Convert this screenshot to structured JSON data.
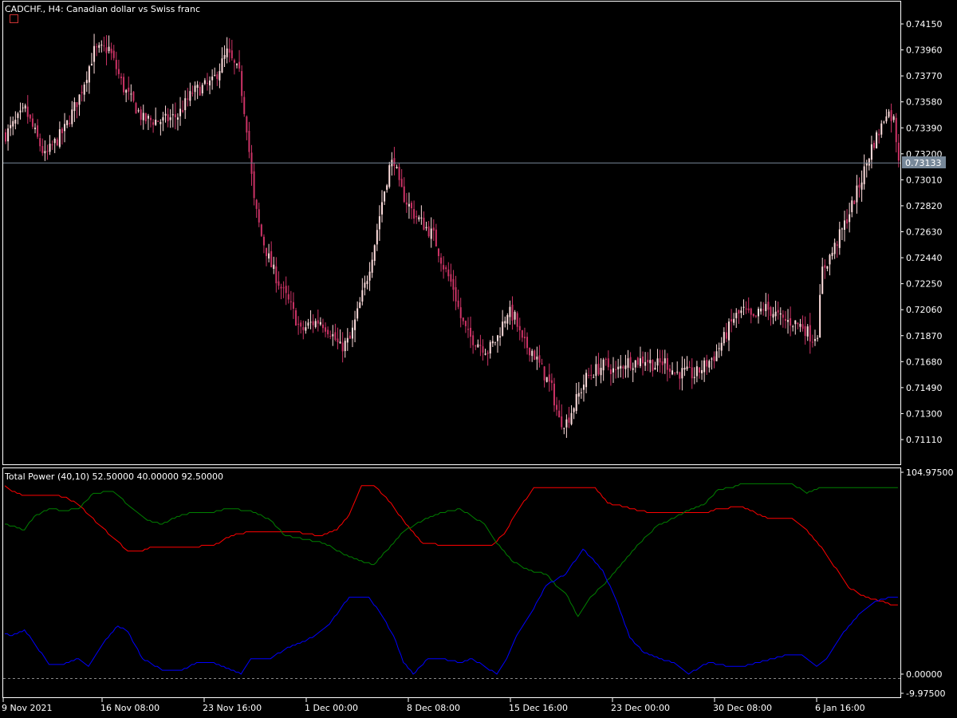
{
  "chart_data": [
    {
      "type": "candlestick",
      "title": "CADCHF., H4:  Canadian dollar vs Swiss franc",
      "y_ticks": [
        "0.74150",
        "0.73960",
        "0.73770",
        "0.73580",
        "0.73390",
        "0.73200",
        "0.73010",
        "0.72820",
        "0.72630",
        "0.72440",
        "0.72250",
        "0.72060",
        "0.71870",
        "0.71680",
        "0.71490",
        "0.71300",
        "0.71110"
      ],
      "ylim": [
        0.71,
        0.7427
      ],
      "current_price": "0.73133",
      "close_anchors": [
        [
          0,
          0.7334
        ],
        [
          8,
          0.7352
        ],
        [
          16,
          0.7318
        ],
        [
          24,
          0.7338
        ],
        [
          30,
          0.7362
        ],
        [
          36,
          0.7395
        ],
        [
          42,
          0.7397
        ],
        [
          48,
          0.7368
        ],
        [
          56,
          0.7345
        ],
        [
          64,
          0.7344
        ],
        [
          70,
          0.7348
        ],
        [
          76,
          0.7365
        ],
        [
          84,
          0.7372
        ],
        [
          90,
          0.7394
        ],
        [
          95,
          0.7378
        ],
        [
          98,
          0.734
        ],
        [
          101,
          0.7285
        ],
        [
          104,
          0.726
        ],
        [
          108,
          0.7238
        ],
        [
          112,
          0.7222
        ],
        [
          116,
          0.7208
        ],
        [
          120,
          0.719
        ],
        [
          124,
          0.7196
        ],
        [
          128,
          0.7198
        ],
        [
          132,
          0.719
        ],
        [
          136,
          0.7178
        ],
        [
          140,
          0.7184
        ],
        [
          144,
          0.721
        ],
        [
          147,
          0.723
        ],
        [
          150,
          0.7255
        ],
        [
          153,
          0.7285
        ],
        [
          156,
          0.731
        ],
        [
          158,
          0.7316
        ],
        [
          160,
          0.7296
        ],
        [
          163,
          0.7285
        ],
        [
          166,
          0.7276
        ],
        [
          170,
          0.7268
        ],
        [
          174,
          0.726
        ],
        [
          178,
          0.7238
        ],
        [
          182,
          0.7222
        ],
        [
          185,
          0.72
        ],
        [
          188,
          0.7187
        ],
        [
          192,
          0.7182
        ],
        [
          196,
          0.7176
        ],
        [
          200,
          0.7186
        ],
        [
          204,
          0.7205
        ],
        [
          207,
          0.72
        ],
        [
          210,
          0.7182
        ],
        [
          214,
          0.7176
        ],
        [
          218,
          0.7162
        ],
        [
          222,
          0.7148
        ],
        [
          225,
          0.7125
        ],
        [
          228,
          0.7124
        ],
        [
          232,
          0.714
        ],
        [
          236,
          0.7156
        ],
        [
          240,
          0.7162
        ],
        [
          244,
          0.7166
        ],
        [
          248,
          0.716
        ],
        [
          252,
          0.7168
        ],
        [
          256,
          0.7168
        ],
        [
          260,
          0.717
        ],
        [
          264,
          0.7165
        ],
        [
          268,
          0.7168
        ],
        [
          272,
          0.716
        ],
        [
          276,
          0.716
        ],
        [
          280,
          0.7158
        ],
        [
          284,
          0.7165
        ],
        [
          288,
          0.7172
        ],
        [
          292,
          0.7185
        ],
        [
          296,
          0.72
        ],
        [
          300,
          0.7205
        ],
        [
          304,
          0.7198
        ],
        [
          308,
          0.7208
        ],
        [
          312,
          0.7204
        ],
        [
          316,
          0.7198
        ],
        [
          320,
          0.7197
        ],
        [
          324,
          0.7194
        ],
        [
          328,
          0.7185
        ],
        [
          330,
          0.719
        ],
        [
          332,
          0.7235
        ],
        [
          336,
          0.7248
        ],
        [
          340,
          0.7264
        ],
        [
          344,
          0.7282
        ],
        [
          348,
          0.7302
        ],
        [
          352,
          0.7325
        ],
        [
          356,
          0.734
        ],
        [
          358,
          0.7352
        ],
        [
          361,
          0.7345
        ],
        [
          363,
          0.7318
        ]
      ]
    },
    {
      "type": "line",
      "title": "Total Power (40,10) 52.50000 40.00000 92.50000",
      "y_ticks": [
        "104.97500",
        "0.00000",
        "-9.97500"
      ],
      "ylim": [
        -9.975,
        104.975
      ],
      "series": [
        {
          "color": "#ff0000",
          "anchors": [
            [
              0,
              98
            ],
            [
              3,
              95
            ],
            [
              8,
              93
            ],
            [
              20,
              93
            ],
            [
              25,
              92
            ],
            [
              30,
              88
            ],
            [
              38,
              78
            ],
            [
              45,
              70
            ],
            [
              50,
              64
            ],
            [
              55,
              64
            ],
            [
              60,
              66
            ],
            [
              75,
              66
            ],
            [
              85,
              67
            ],
            [
              92,
              72
            ],
            [
              100,
              74
            ],
            [
              118,
              74
            ],
            [
              128,
              72
            ],
            [
              135,
              75
            ],
            [
              140,
              83
            ],
            [
              145,
              98
            ],
            [
              150,
              98
            ],
            [
              155,
              92
            ],
            [
              163,
              78
            ],
            [
              170,
              68
            ],
            [
              180,
              67
            ],
            [
              198,
              67
            ],
            [
              203,
              73
            ],
            [
              208,
              84
            ],
            [
              215,
              97
            ],
            [
              240,
              97
            ],
            [
              245,
              89
            ],
            [
              255,
              86
            ],
            [
              262,
              84
            ],
            [
              285,
              84
            ],
            [
              290,
              86
            ],
            [
              300,
              87
            ],
            [
              305,
              84
            ],
            [
              310,
              81
            ],
            [
              320,
              81
            ],
            [
              325,
              76
            ],
            [
              333,
              64
            ],
            [
              343,
              45
            ],
            [
              350,
              40
            ],
            [
              356,
              38
            ],
            [
              360,
              36
            ]
          ]
        },
        {
          "color": "#008000",
          "anchors": [
            [
              0,
              78
            ],
            [
              8,
              75
            ],
            [
              12,
              82
            ],
            [
              18,
              86
            ],
            [
              24,
              85
            ],
            [
              30,
              86
            ],
            [
              36,
              94
            ],
            [
              44,
              95
            ],
            [
              52,
              86
            ],
            [
              58,
              80
            ],
            [
              64,
              78
            ],
            [
              70,
              82
            ],
            [
              76,
              84
            ],
            [
              84,
              84
            ],
            [
              90,
              86
            ],
            [
              100,
              85
            ],
            [
              108,
              80
            ],
            [
              114,
              72
            ],
            [
              122,
              70
            ],
            [
              130,
              68
            ],
            [
              138,
              62
            ],
            [
              146,
              58
            ],
            [
              150,
              57
            ],
            [
              155,
              64
            ],
            [
              162,
              74
            ],
            [
              170,
              80
            ],
            [
              178,
              84
            ],
            [
              185,
              86
            ],
            [
              190,
              82
            ],
            [
              195,
              78
            ],
            [
              200,
              68
            ],
            [
              206,
              59
            ],
            [
              213,
              54
            ],
            [
              220,
              52
            ],
            [
              225,
              45
            ],
            [
              228,
              42
            ],
            [
              233,
              30
            ],
            [
              238,
              40
            ],
            [
              243,
              46
            ],
            [
              250,
              56
            ],
            [
              258,
              68
            ],
            [
              265,
              77
            ],
            [
              270,
              80
            ],
            [
              276,
              84
            ],
            [
              284,
              88
            ],
            [
              290,
              96
            ],
            [
              295,
              97
            ],
            [
              300,
              99
            ],
            [
              320,
              99
            ],
            [
              326,
              94
            ],
            [
              332,
              97
            ],
            [
              340,
              97
            ],
            [
              350,
              97
            ],
            [
              360,
              97
            ]
          ]
        },
        {
          "color": "#0000ff",
          "anchors": [
            [
              0,
              21
            ],
            [
              3,
              20
            ],
            [
              8,
              23
            ],
            [
              12,
              16
            ],
            [
              18,
              5
            ],
            [
              24,
              5
            ],
            [
              30,
              8
            ],
            [
              34,
              4
            ],
            [
              40,
              16
            ],
            [
              46,
              25
            ],
            [
              50,
              22
            ],
            [
              56,
              8
            ],
            [
              64,
              2
            ],
            [
              72,
              2
            ],
            [
              78,
              6
            ],
            [
              84,
              6
            ],
            [
              92,
              2
            ],
            [
              96,
              0
            ],
            [
              100,
              8
            ],
            [
              108,
              8
            ],
            [
              114,
              13
            ],
            [
              120,
              16
            ],
            [
              126,
              20
            ],
            [
              132,
              26
            ],
            [
              140,
              40
            ],
            [
              148,
              40
            ],
            [
              153,
              31
            ],
            [
              158,
              20
            ],
            [
              162,
              6
            ],
            [
              166,
              0
            ],
            [
              172,
              8
            ],
            [
              178,
              8
            ],
            [
              185,
              6
            ],
            [
              190,
              8
            ],
            [
              196,
              3
            ],
            [
              200,
              0
            ],
            [
              204,
              8
            ],
            [
              208,
              20
            ],
            [
              214,
              32
            ],
            [
              220,
              46
            ],
            [
              228,
              52
            ],
            [
              235,
              65
            ],
            [
              243,
              54
            ],
            [
              248,
              40
            ],
            [
              254,
              19
            ],
            [
              260,
              11
            ],
            [
              266,
              8
            ],
            [
              272,
              6
            ],
            [
              278,
              0
            ],
            [
              286,
              6
            ],
            [
              294,
              4
            ],
            [
              300,
              4
            ],
            [
              306,
              6
            ],
            [
              312,
              8
            ],
            [
              318,
              10
            ],
            [
              324,
              10
            ],
            [
              330,
              4
            ],
            [
              334,
              8
            ],
            [
              340,
              20
            ],
            [
              348,
              32
            ],
            [
              354,
              38
            ],
            [
              360,
              40
            ]
          ]
        }
      ]
    }
  ],
  "x_ticks": [
    "9 Nov 2021",
    "16 Nov 08:00",
    "23 Nov 16:00",
    "1 Dec 00:00",
    "8 Dec 08:00",
    "15 Dec 16:00",
    "23 Dec 00:00",
    "30 Dec 08:00",
    "6 Jan 16:00"
  ],
  "colors": {
    "bull": "#ffdddd",
    "bear": "#cc3366",
    "grid": "#ffffff",
    "bid_line": "#778899",
    "bid_bg": "#778899",
    "axis": "#ffffff"
  }
}
